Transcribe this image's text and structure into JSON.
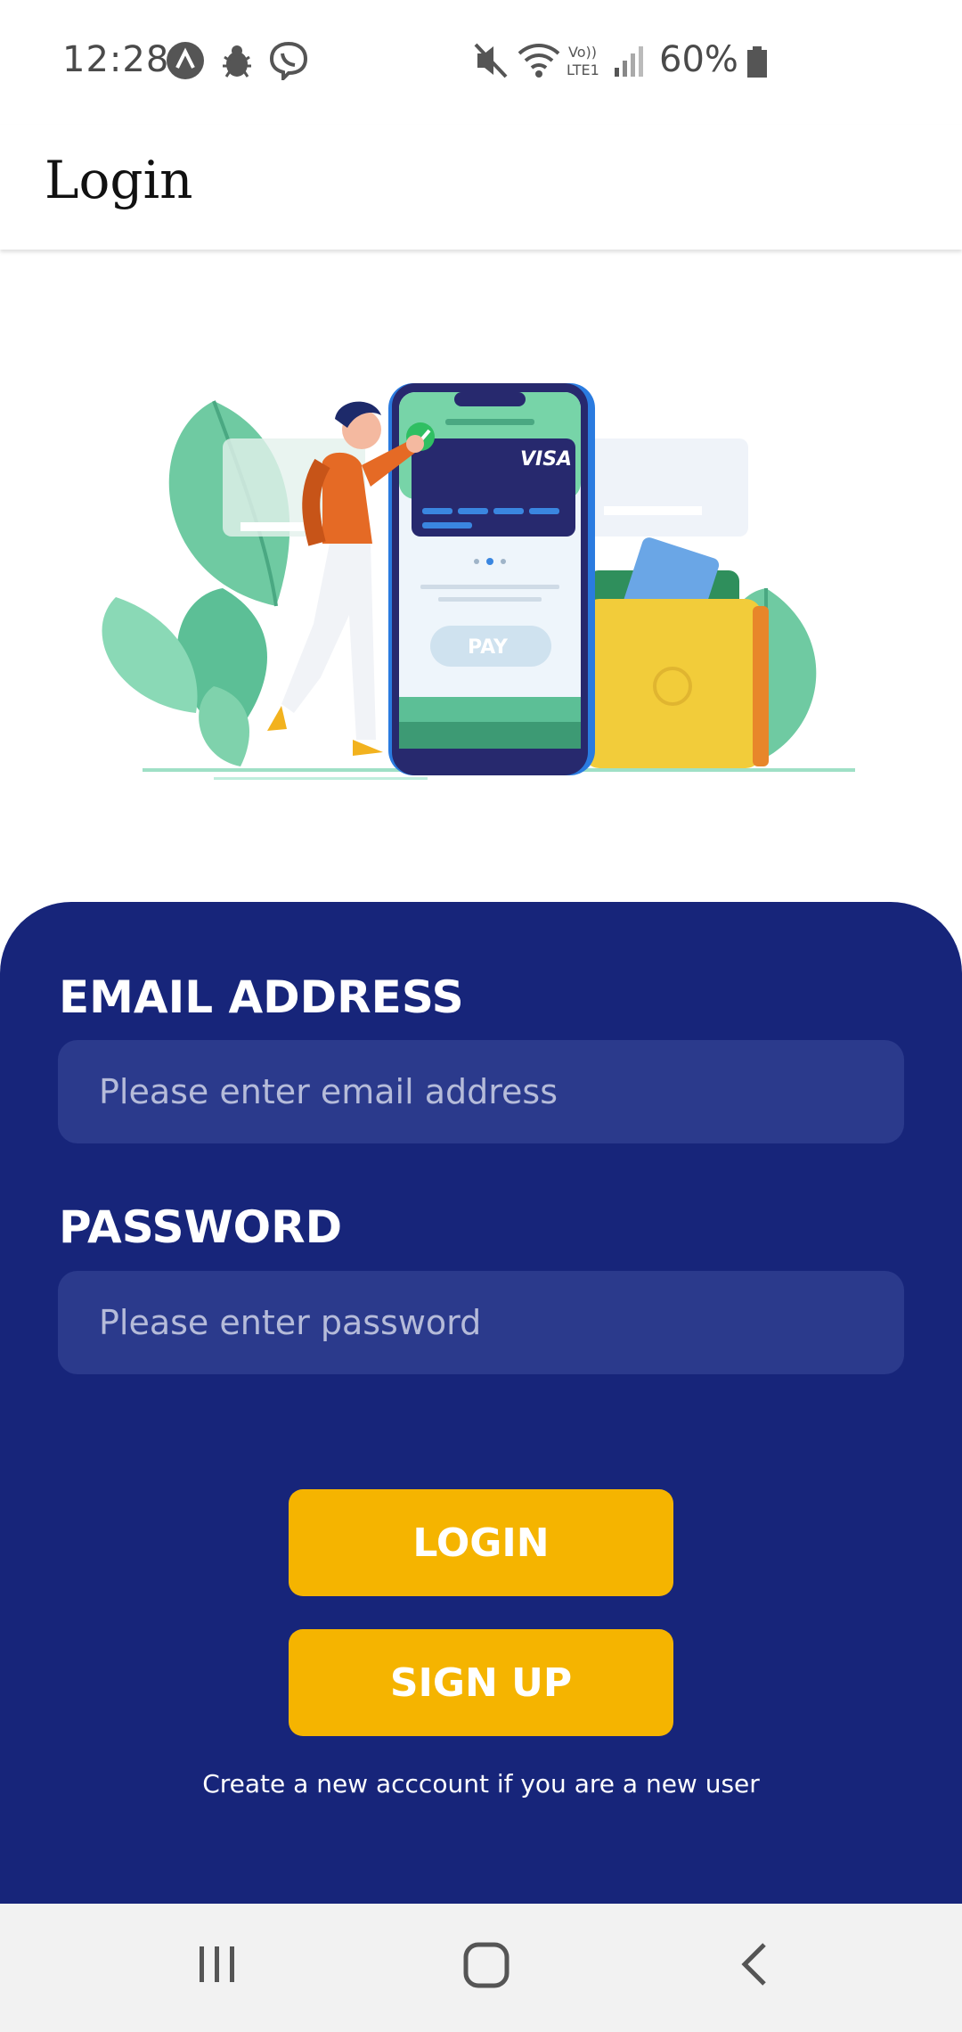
{
  "status_bar": {
    "time": "12:28",
    "battery_percent": "60%",
    "icons": [
      "app-a-icon",
      "bug-icon",
      "viber-icon",
      "mute-icon",
      "wifi-icon",
      "volte-icon",
      "signal-icon",
      "battery-icon"
    ]
  },
  "app_bar": {
    "title": "Login"
  },
  "illustration": {
    "name": "payment-illustration",
    "card_brand": "VISA",
    "pay_label": "PAY"
  },
  "form": {
    "email_label": "EMAIL ADDRESS",
    "email_placeholder": "Please enter email address",
    "password_label": "PASSWORD",
    "password_placeholder": "Please enter password",
    "login_label": "LOGIN",
    "signup_label": "SIGN UP",
    "helper": "Create a new acccount if you are a new user"
  },
  "nav_bar": {
    "buttons": [
      "recents-icon",
      "home-icon",
      "back-icon"
    ]
  },
  "colors": {
    "panel": "#17257a",
    "input": "#2b3a8c",
    "button": "#f5b400",
    "nav": "#f2f2f2"
  }
}
